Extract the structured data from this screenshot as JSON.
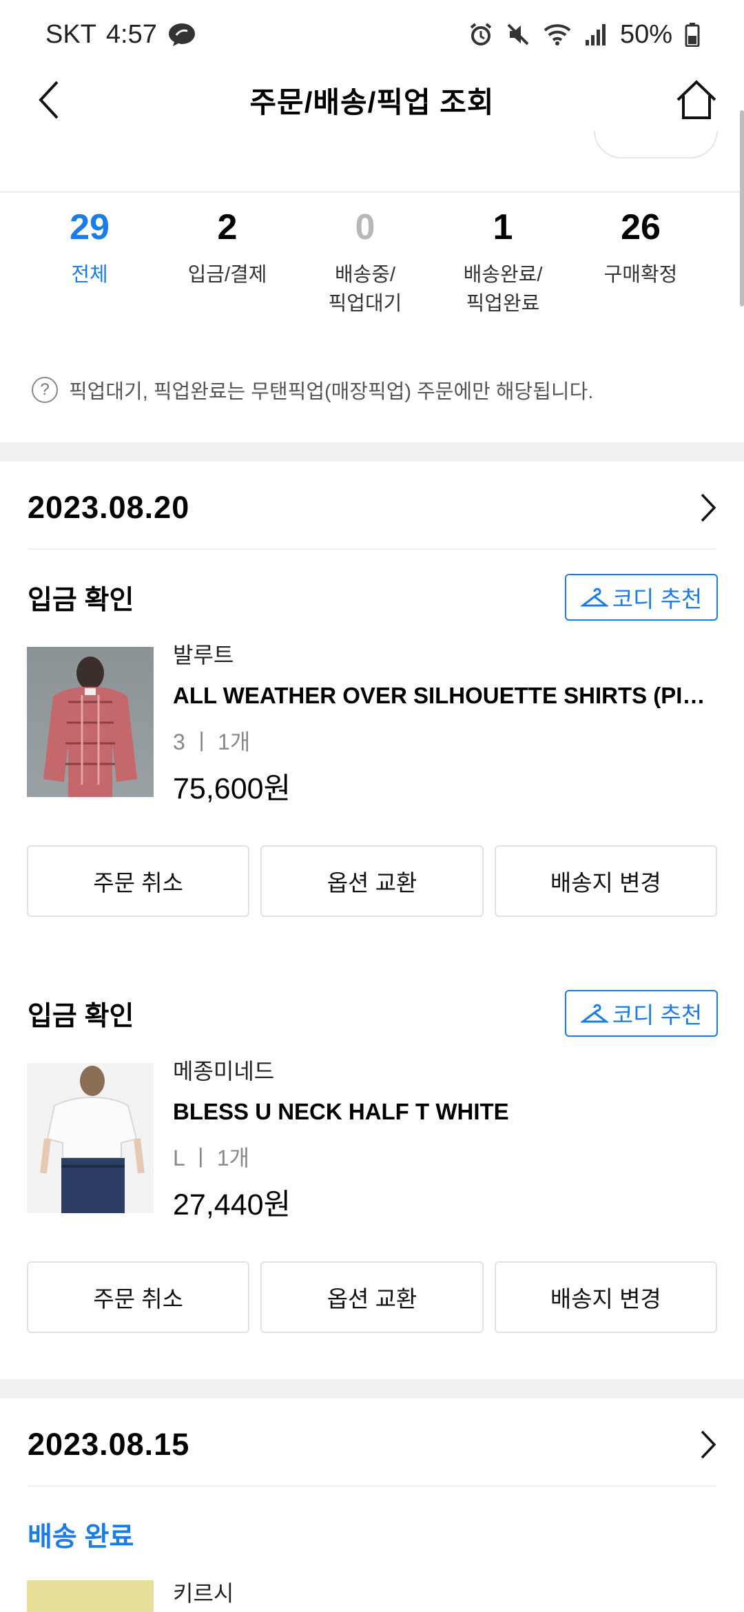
{
  "status_bar": {
    "carrier": "SKT",
    "time": "4:57",
    "battery": "50%",
    "icons": [
      "chat-bubble-icon",
      "alarm-icon",
      "mute-icon",
      "wifi-icon",
      "signal-icon",
      "battery-icon"
    ]
  },
  "header": {
    "title": "주문/배송/픽업 조회"
  },
  "summary": {
    "items": [
      {
        "count": "29",
        "label": "전체",
        "color": "#1a7ce8"
      },
      {
        "count": "2",
        "label": "입금/결제",
        "color": "#000000"
      },
      {
        "count": "0",
        "label": "배송중/\n픽업대기",
        "color": "#b7b7b7"
      },
      {
        "count": "1",
        "label": "배송완료/\n픽업완료",
        "color": "#000000"
      },
      {
        "count": "26",
        "label": "구매확정",
        "color": "#000000"
      }
    ]
  },
  "notice": "픽업대기, 픽업완료는 무탠픽업(매장픽업) 주문에만 해당됩니다.",
  "groups": [
    {
      "date": "2023.08.20",
      "orders": [
        {
          "status": "입금 확인",
          "coord_label": "코디 추천",
          "brand": "발루트",
          "name": "ALL WEATHER OVER SILHOUETTE SHIRTS (PINK)",
          "option": "3 ㅣ 1개",
          "price": "75,600원",
          "actions": [
            "주문 취소",
            "옵션 교환",
            "배송지 변경"
          ]
        },
        {
          "status": "입금 확인",
          "coord_label": "코디 추천",
          "brand": "메종미네드",
          "name": "BLESS U NECK HALF T WHITE",
          "option": "L ㅣ 1개",
          "price": "27,440원",
          "actions": [
            "주문 취소",
            "옵션 교환",
            "배송지 변경"
          ]
        }
      ]
    },
    {
      "date": "2023.08.15",
      "orders": [
        {
          "status": "배송 완료",
          "brand": "키르시"
        }
      ]
    }
  ],
  "colors": {
    "accent": "#1a7ce8",
    "divider_band": "#f1f1f1"
  }
}
